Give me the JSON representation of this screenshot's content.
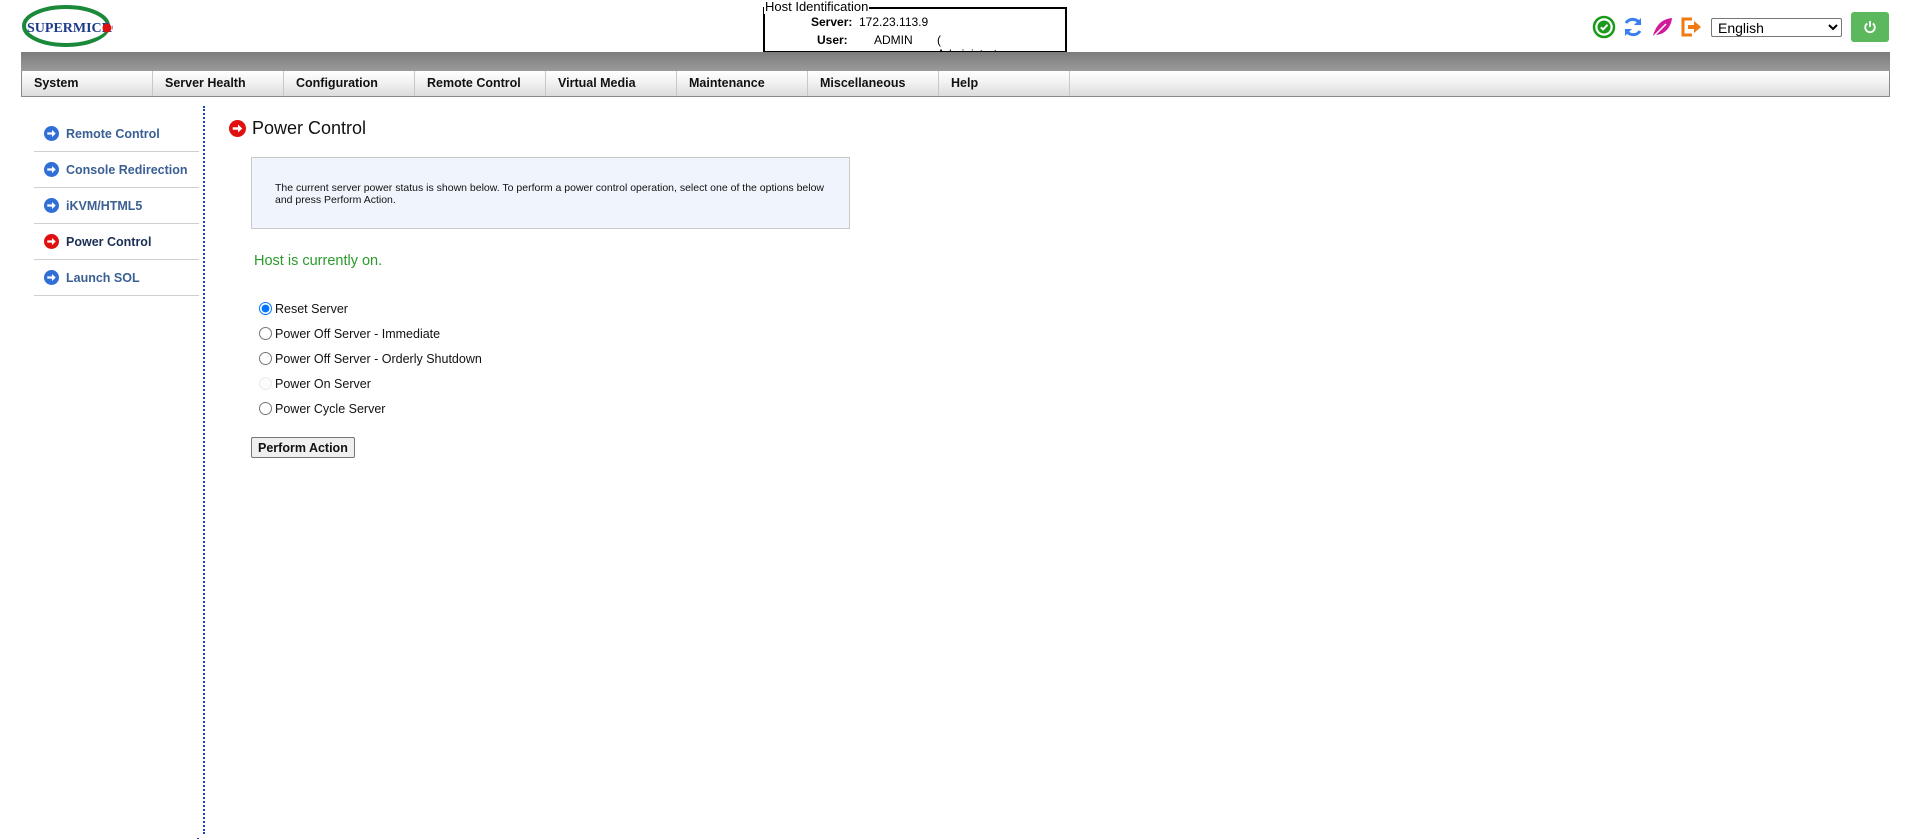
{
  "brand": {
    "logo_text": "SUPERMICRO",
    "logo_mark": "®"
  },
  "host_identification": {
    "legend": "Host Identification",
    "server_label": "Server:",
    "server_value": "172.23.113.9",
    "user_label": "User:",
    "user_value": "ADMIN",
    "user_role": "( Administrator )"
  },
  "toolbar": {
    "icons": [
      "check-circle-icon",
      "refresh-icon",
      "leaf-icon",
      "logout-icon"
    ],
    "language": {
      "selected": "English"
    },
    "power_button": "power-icon",
    "colors": {
      "check": "#1a9a1a",
      "refresh": "#3a7ff0",
      "leaf": "#d01a9a",
      "logout": "#f07a10",
      "power_bg": "#5cb85c"
    }
  },
  "nav": {
    "items": [
      {
        "label": "System"
      },
      {
        "label": "Server Health"
      },
      {
        "label": "Configuration"
      },
      {
        "label": "Remote Control"
      },
      {
        "label": "Virtual Media"
      },
      {
        "label": "Maintenance"
      },
      {
        "label": "Miscellaneous"
      },
      {
        "label": "Help"
      }
    ]
  },
  "sidebar": {
    "items": [
      {
        "label": "Remote Control",
        "active": false
      },
      {
        "label": "Console Redirection",
        "active": false
      },
      {
        "label": "iKVM/HTML5",
        "active": false
      },
      {
        "label": "Power Control",
        "active": true
      },
      {
        "label": "Launch SOL",
        "active": false
      }
    ],
    "colors": {
      "inactive_arrow": "#2f6fd6",
      "active_arrow": "#e01010"
    }
  },
  "main": {
    "title": "Power Control",
    "info_text": "The current server power status is shown below. To perform a power control operation, select one of the options below and press Perform Action.",
    "host_status": "Host is currently on.",
    "options": [
      {
        "label": "Reset Server",
        "checked": true,
        "disabled": false
      },
      {
        "label": "Power Off Server - Immediate",
        "checked": false,
        "disabled": false
      },
      {
        "label": "Power Off Server - Orderly Shutdown",
        "checked": false,
        "disabled": false
      },
      {
        "label": "Power On Server",
        "checked": false,
        "disabled": true
      },
      {
        "label": "Power Cycle Server",
        "checked": false,
        "disabled": false
      }
    ],
    "perform_button": "Perform Action"
  }
}
